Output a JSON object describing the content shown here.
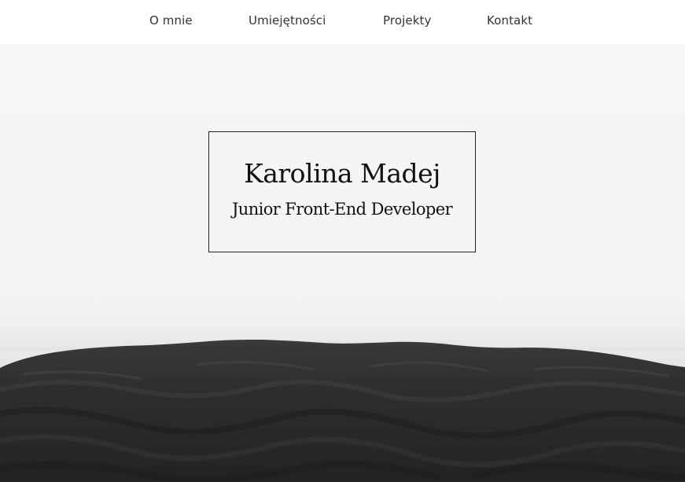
{
  "nav": {
    "items": [
      {
        "label": "O mnie"
      },
      {
        "label": "Umiejętności"
      },
      {
        "label": "Projekty"
      },
      {
        "label": "Kontakt"
      }
    ]
  },
  "hero": {
    "name": "Karolina Madej",
    "role": "Junior Front-End Developer",
    "image": "dark-sand-dunes"
  },
  "colors": {
    "nav_background": "#ffffff",
    "nav_text": "#333333",
    "sky": "#f5f5f4",
    "dunes": "#2b2b2c",
    "title_text": "#111111",
    "card_border": "#222222"
  }
}
